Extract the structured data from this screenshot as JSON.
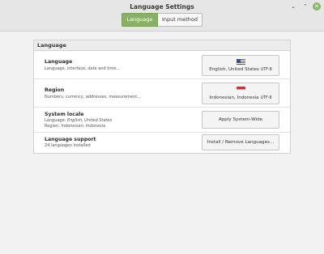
{
  "window": {
    "title": "Language Settings",
    "minimize_glyph": "⌄",
    "maximize_glyph": "⌃",
    "close_glyph": "✕"
  },
  "tabs": [
    {
      "label": "Language",
      "active": true
    },
    {
      "label": "Input method",
      "active": false
    }
  ],
  "panel": {
    "title": "Language",
    "rows": [
      {
        "title": "Language",
        "subtitle": "Language, interface, date and time...",
        "button": {
          "label": "English, United States",
          "encoding": "UTF-8",
          "flag": "us-flag-icon"
        }
      },
      {
        "title": "Region",
        "subtitle": "Numbers, currency, addresses, measurement...",
        "button": {
          "label": "Indonesian, Indonesia",
          "encoding": "UTF-8",
          "flag": "id-flag-icon"
        }
      },
      {
        "title": "System locale",
        "subtitle_line1_prefix": "Language: ",
        "subtitle_line1_value": "English, United States",
        "subtitle_line2_prefix": "Region: ",
        "subtitle_line2_value": "Indonesian, Indonesia",
        "button": {
          "label": "Apply System-Wide"
        }
      },
      {
        "title": "Language support",
        "subtitle": "24 languages installed",
        "button": {
          "label": "Install / Remove Languages..."
        }
      }
    ]
  },
  "colors": {
    "accent": "#8ab066",
    "close_button": "#8cb56a"
  }
}
